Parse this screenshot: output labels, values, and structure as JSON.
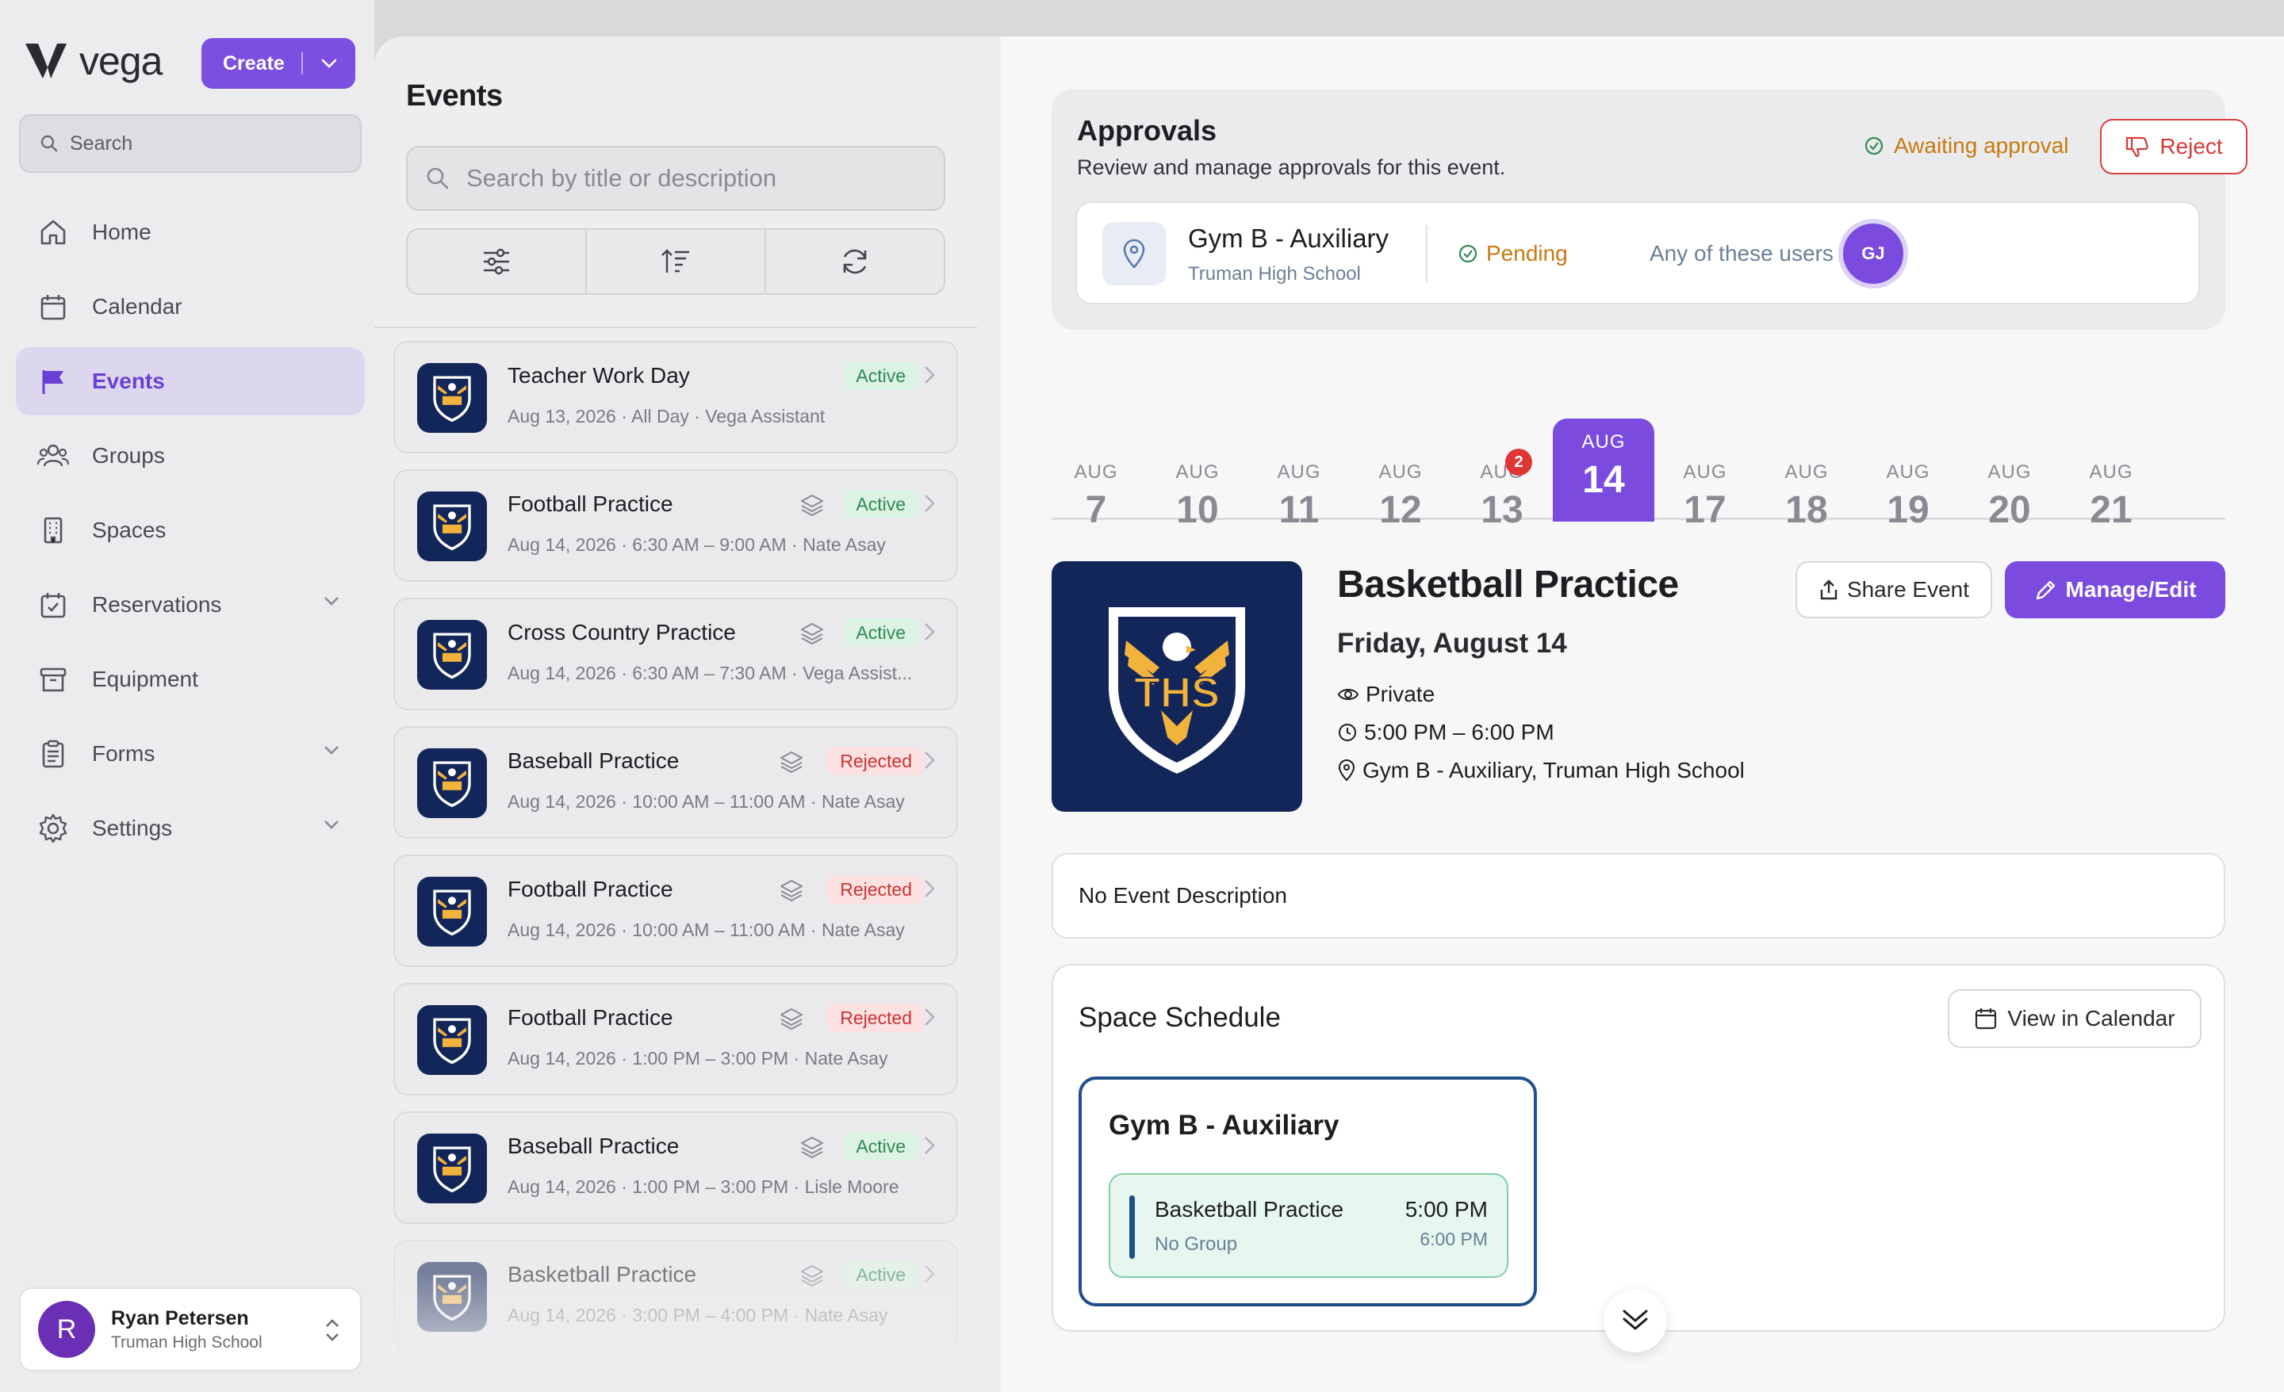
{
  "brand": {
    "name": "vega"
  },
  "create": {
    "label": "Create"
  },
  "sidebar": {
    "search_label": "Search",
    "items": [
      {
        "label": "Home",
        "icon": "home-icon"
      },
      {
        "label": "Calendar",
        "icon": "calendar-icon"
      },
      {
        "label": "Events",
        "icon": "flag-icon",
        "active": true
      },
      {
        "label": "Groups",
        "icon": "users-icon"
      },
      {
        "label": "Spaces",
        "icon": "building-icon"
      },
      {
        "label": "Reservations",
        "icon": "calendar-check-icon",
        "expandable": true
      },
      {
        "label": "Equipment",
        "icon": "archive-icon"
      },
      {
        "label": "Forms",
        "icon": "clipboard-icon",
        "expandable": true
      },
      {
        "label": "Settings",
        "icon": "gear-icon",
        "expandable": true
      }
    ],
    "user": {
      "initial": "R",
      "name": "Ryan Petersen",
      "org": "Truman High School"
    }
  },
  "events_panel": {
    "title": "Events",
    "search_placeholder": "Search by title or description",
    "items": [
      {
        "title": "Teacher Work Day",
        "meta": "Aug 13, 2026 · All Day · Vega Assistant",
        "status": "Active",
        "layers": false
      },
      {
        "title": "Football Practice",
        "meta": "Aug 14, 2026 · 6:30 AM – 9:00 AM · Nate Asay",
        "status": "Active",
        "layers": true
      },
      {
        "title": "Cross Country Practice",
        "meta": "Aug 14, 2026 · 6:30 AM – 7:30 AM · Vega Assist...",
        "status": "Active",
        "layers": true
      },
      {
        "title": "Baseball Practice",
        "meta": "Aug 14, 2026 · 10:00 AM – 11:00 AM · Nate Asay",
        "status": "Rejected",
        "layers": true
      },
      {
        "title": "Football Practice",
        "meta": "Aug 14, 2026 · 10:00 AM – 11:00 AM · Nate Asay",
        "status": "Rejected",
        "layers": true
      },
      {
        "title": "Football Practice",
        "meta": "Aug 14, 2026 · 1:00 PM – 3:00 PM · Nate Asay",
        "status": "Rejected",
        "layers": true
      },
      {
        "title": "Baseball Practice",
        "meta": "Aug 14, 2026 · 1:00 PM – 3:00 PM · Lisle Moore",
        "status": "Active",
        "layers": true
      },
      {
        "title": "Basketball Practice",
        "meta": "Aug 14, 2026 · 3:00 PM – 4:00 PM · Nate Asay",
        "status": "Active",
        "layers": true
      }
    ]
  },
  "approvals": {
    "title": "Approvals",
    "subtitle": "Review and manage approvals for this event.",
    "status": "Awaiting approval",
    "reject_label": "Reject",
    "row": {
      "space": "Gym B - Auxiliary",
      "school": "Truman High School",
      "status": "Pending",
      "users_label": "Any of these users",
      "user_initials": "GJ"
    }
  },
  "dates": [
    {
      "month": "AUG",
      "day": "7"
    },
    {
      "month": "AUG",
      "day": "10"
    },
    {
      "month": "AUG",
      "day": "11"
    },
    {
      "month": "AUG",
      "day": "12"
    },
    {
      "month": "AUG",
      "day": "13",
      "badge": "2"
    },
    {
      "month": "AUG",
      "day": "14",
      "selected": true
    },
    {
      "month": "AUG",
      "day": "17"
    },
    {
      "month": "AUG",
      "day": "18"
    },
    {
      "month": "AUG",
      "day": "19"
    },
    {
      "month": "AUG",
      "day": "20"
    },
    {
      "month": "AUG",
      "day": "21"
    }
  ],
  "event": {
    "logo_text": "THS",
    "title": "Basketball Practice",
    "date": "Friday, August 14",
    "visibility": "Private",
    "time": "5:00 PM – 6:00 PM",
    "location": "Gym B - Auxiliary, Truman High School",
    "share_label": "Share Event",
    "edit_label": "Manage/Edit",
    "description": "No Event Description"
  },
  "schedule": {
    "title": "Space Schedule",
    "calendar_label": "View in Calendar",
    "space": "Gym B - Auxiliary",
    "booking": {
      "title": "Basketball Practice",
      "group": "No Group",
      "start": "5:00 PM",
      "end": "6:00 PM"
    }
  },
  "colors": {
    "accent": "#7b4be0",
    "active": "#2e8a52",
    "rejected": "#cc3333",
    "pending": "#c77a10",
    "navy": "#13265a",
    "gold": "#f2b33d"
  }
}
